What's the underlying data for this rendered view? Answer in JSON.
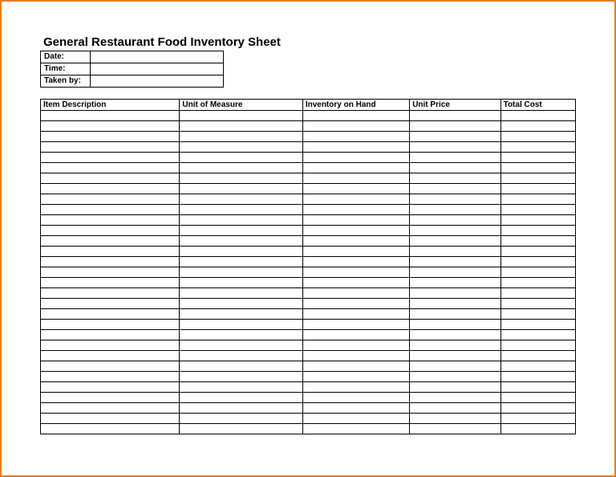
{
  "title": "General Restaurant Food Inventory Sheet",
  "meta": {
    "date_label": "Date:",
    "date_value": "",
    "time_label": "Time:",
    "time_value": "",
    "taken_by_label": "Taken by:",
    "taken_by_value": ""
  },
  "columns": {
    "c0": "Item Description",
    "c1": "Unit of Measure",
    "c2": "Inventory on Hand",
    "c3": "Unit Price",
    "c4": "Total Cost"
  },
  "row_count": 31
}
